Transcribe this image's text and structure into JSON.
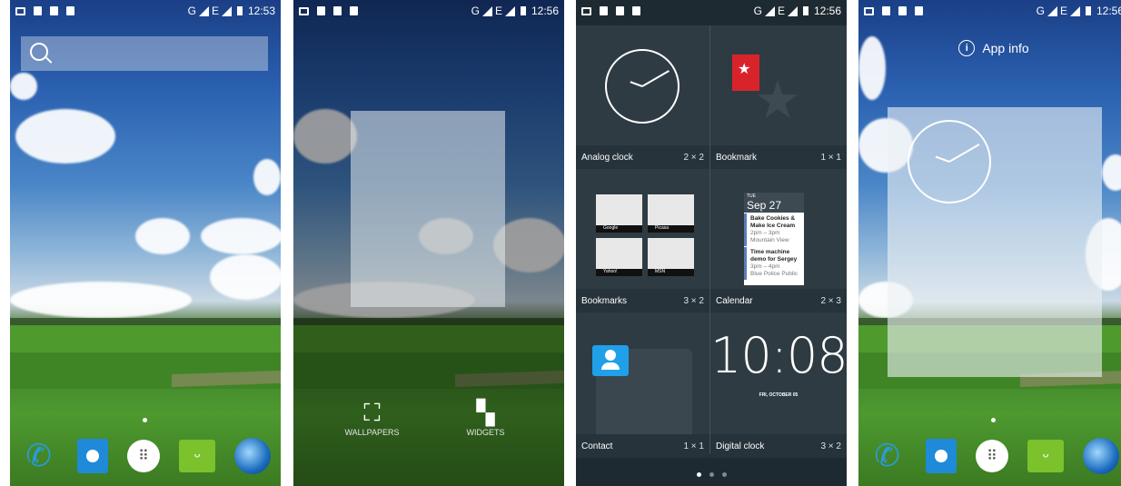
{
  "screens": [
    {
      "status_time": "12:53",
      "network": "G",
      "network2": "E"
    },
    {
      "status_time": "12:56",
      "network": "G",
      "network2": "E"
    },
    {
      "status_time": "12:56",
      "network": "G",
      "network2": "E"
    },
    {
      "status_time": "12:56",
      "network": "G",
      "network2": "E"
    }
  ],
  "home": {
    "dock_icons": [
      "phone-icon",
      "contacts-icon",
      "app-drawer-icon",
      "messaging-icon",
      "browser-icon"
    ]
  },
  "overview": {
    "wallpapers_label": "WALLPAPERS",
    "widgets_label": "WIDGETS"
  },
  "widgets": [
    {
      "name": "Analog clock",
      "size": "2 × 2"
    },
    {
      "name": "Bookmark",
      "size": "1 × 1"
    },
    {
      "name": "Bookmarks",
      "size": "3 × 2"
    },
    {
      "name": "Calendar",
      "size": "2 × 3"
    },
    {
      "name": "Contact",
      "size": "1 × 1"
    },
    {
      "name": "Digital clock",
      "size": "3 × 2"
    }
  ],
  "bookmark_thumbs": [
    "Google",
    "Picasa",
    "Yahoo!",
    "MSN"
  ],
  "calendar_preview": {
    "day": "TUE",
    "date": "Sep 27",
    "events": [
      {
        "title": "Bake Cookies & Make Ice Cream",
        "time": "2pm – 3pm",
        "place": "Mountain View"
      },
      {
        "title": "Time machine demo for Sergey",
        "time": "3pm – 4pm",
        "place": "Blue Police Public"
      }
    ]
  },
  "digital_clock_preview": {
    "time": "10:08",
    "date": "FRI, OCTOBER 05"
  },
  "app_info": {
    "label": "App info"
  },
  "colors": {
    "accent": "#1fa0e8",
    "widget_bg": "#1e2a31",
    "bookmark_red": "#d9232a"
  }
}
